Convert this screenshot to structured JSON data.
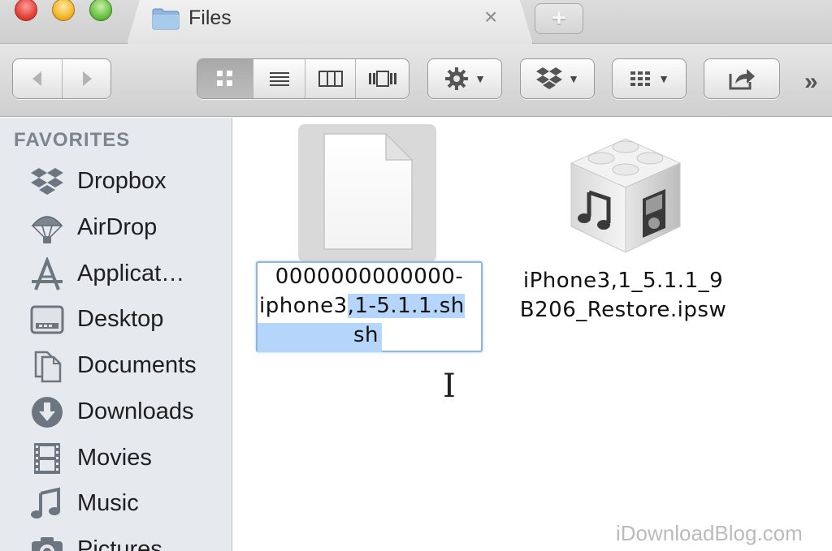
{
  "window": {
    "tab_title": "Files",
    "tab_close": "×",
    "new_tab": "+"
  },
  "toolbar": {
    "back_icon": "chevron-left-icon",
    "forward_icon": "chevron-right-icon",
    "view_modes": [
      "icon-view",
      "list-view",
      "column-view",
      "cover-flow-view"
    ],
    "selected_view": "icon-view",
    "action_caret": "▼",
    "dropbox_caret": "▼",
    "arrange_caret": "▼",
    "overflow": "»"
  },
  "sidebar": {
    "heading": "FAVORITES",
    "items": [
      {
        "label": "Dropbox",
        "icon": "dropbox-icon"
      },
      {
        "label": "AirDrop",
        "icon": "airdrop-icon"
      },
      {
        "label": "Applicat…",
        "icon": "applications-icon"
      },
      {
        "label": "Desktop",
        "icon": "desktop-icon"
      },
      {
        "label": "Documents",
        "icon": "documents-icon"
      },
      {
        "label": "Downloads",
        "icon": "downloads-icon"
      },
      {
        "label": "Movies",
        "icon": "movies-icon"
      },
      {
        "label": "Music",
        "icon": "music-icon"
      },
      {
        "label": "Pictures",
        "icon": "pictures-icon"
      }
    ]
  },
  "files": {
    "shsh": {
      "line1": "0000000000000-",
      "line2_plain": "iphone3",
      "line2_selected": ",1-5.1.1.sh",
      "line3_selected": "sh"
    },
    "ipsw": {
      "line1": "iPhone3,1_5.1.1_9",
      "line2": "B206_Restore.ipsw"
    }
  },
  "cursor": "I",
  "watermark": "iDownloadBlog.com",
  "colors": {
    "selection": "#b5d5fb",
    "sidebar_bg": "#e6eaee",
    "sidebar_heading": "#7b8590"
  }
}
